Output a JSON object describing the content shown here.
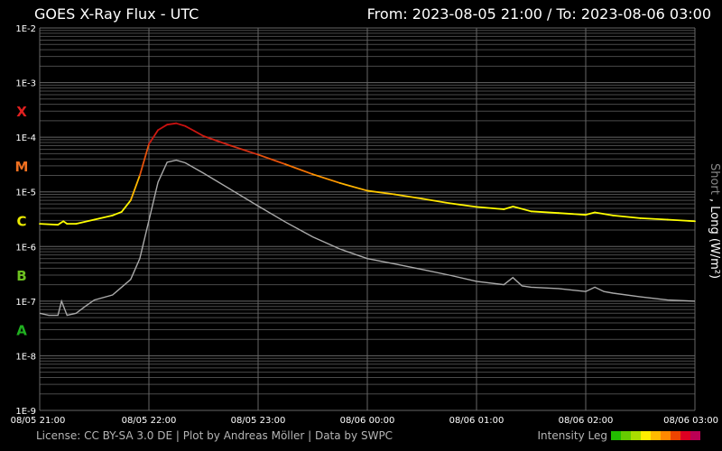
{
  "header": {
    "title": "GOES X-Ray Flux - UTC",
    "range": "From: 2023-08-05 21:00  /  To: 2023-08-06 03:00"
  },
  "footer": {
    "credits": "License: CC BY-SA 3.0 DE | Plot by Andreas Möller | Data by SWPC",
    "legend_label": "Intensity Leg",
    "legend_colors": [
      "#22bb00",
      "#66cc00",
      "#aadd00",
      "#ffee00",
      "#ffbb00",
      "#ff8800",
      "#ee4400",
      "#dd0022",
      "#bb0055"
    ]
  },
  "colors": {
    "class_X": "#e02020",
    "class_M": "#f07020",
    "class_C": "#e8e800",
    "class_B": "#6cc020",
    "class_A": "#20b020",
    "long_series_low": "#ffff00",
    "long_series_peak": "#cc1010",
    "short_series": "#aaaaaa",
    "grid": "#4a4a4a"
  },
  "chart_data": {
    "type": "line",
    "title": "GOES X-Ray Flux - UTC",
    "xlabel": "",
    "ylabel": "Short , Long (W/m²)",
    "ylabel_short": "Short",
    "ylabel_long": "Long (W/m²)",
    "y_scale": "log",
    "ylim": [
      1e-09,
      0.01
    ],
    "xlim": [
      "2023-08-05 21:00",
      "2023-08-06 03:00"
    ],
    "y_ticks": [
      "1E-2",
      "1E-3",
      "1E-4",
      "1E-5",
      "1E-6",
      "1E-7",
      "1E-8",
      "1E-9"
    ],
    "x_ticks": [
      "08/05 21:00",
      "08/05 22:00",
      "08/05 23:00",
      "08/06 00:00",
      "08/06 01:00",
      "08/06 02:00",
      "08/06 03:00"
    ],
    "flare_classes": [
      {
        "label": "X",
        "value": 0.0003
      },
      {
        "label": "M",
        "value": 3e-05
      },
      {
        "label": "C",
        "value": 3e-06
      },
      {
        "label": "B",
        "value": 3e-07
      },
      {
        "label": "A",
        "value": 3e-08
      }
    ],
    "grid": true,
    "series": [
      {
        "name": "Long",
        "x": [
          "2023-08-05 21:00",
          "2023-08-05 21:10",
          "2023-08-05 21:13",
          "2023-08-05 21:15",
          "2023-08-05 21:20",
          "2023-08-05 21:30",
          "2023-08-05 21:40",
          "2023-08-05 21:45",
          "2023-08-05 21:50",
          "2023-08-05 21:55",
          "2023-08-05 22:00",
          "2023-08-05 22:05",
          "2023-08-05 22:10",
          "2023-08-05 22:15",
          "2023-08-05 22:20",
          "2023-08-05 22:25",
          "2023-08-05 22:30",
          "2023-08-05 22:45",
          "2023-08-05 23:00",
          "2023-08-05 23:15",
          "2023-08-05 23:30",
          "2023-08-05 23:45",
          "2023-08-06 00:00",
          "2023-08-06 00:15",
          "2023-08-06 00:30",
          "2023-08-06 00:45",
          "2023-08-06 01:00",
          "2023-08-06 01:15",
          "2023-08-06 01:20",
          "2023-08-06 01:30",
          "2023-08-06 01:45",
          "2023-08-06 02:00",
          "2023-08-06 02:05",
          "2023-08-06 02:15",
          "2023-08-06 02:30",
          "2023-08-06 02:45",
          "2023-08-06 03:00"
        ],
        "y": [
          2.6e-06,
          2.5e-06,
          2.9e-06,
          2.6e-06,
          2.6e-06,
          3.1e-06,
          3.7e-06,
          4.3e-06,
          7e-06,
          2e-05,
          7.5e-05,
          0.000135,
          0.00017,
          0.00018,
          0.00016,
          0.00013,
          0.000105,
          7e-05,
          4.8e-05,
          3.2e-05,
          2.1e-05,
          1.45e-05,
          1.05e-05,
          9e-06,
          7.5e-06,
          6.2e-06,
          5.3e-06,
          4.8e-06,
          5.4e-06,
          4.4e-06,
          4.1e-06,
          3.8e-06,
          4.2e-06,
          3.7e-06,
          3.3e-06,
          3.1e-06,
          2.9e-06
        ]
      },
      {
        "name": "Short",
        "x": [
          "2023-08-05 21:00",
          "2023-08-05 21:05",
          "2023-08-05 21:10",
          "2023-08-05 21:12",
          "2023-08-05 21:15",
          "2023-08-05 21:20",
          "2023-08-05 21:25",
          "2023-08-05 21:30",
          "2023-08-05 21:40",
          "2023-08-05 21:50",
          "2023-08-05 21:55",
          "2023-08-05 22:00",
          "2023-08-05 22:05",
          "2023-08-05 22:10",
          "2023-08-05 22:15",
          "2023-08-05 22:20",
          "2023-08-05 22:30",
          "2023-08-05 22:45",
          "2023-08-05 23:00",
          "2023-08-05 23:15",
          "2023-08-05 23:30",
          "2023-08-05 23:45",
          "2023-08-06 00:00",
          "2023-08-06 00:15",
          "2023-08-06 00:30",
          "2023-08-06 00:45",
          "2023-08-06 01:00",
          "2023-08-06 01:15",
          "2023-08-06 01:20",
          "2023-08-06 01:25",
          "2023-08-06 01:30",
          "2023-08-06 01:45",
          "2023-08-06 02:00",
          "2023-08-06 02:05",
          "2023-08-06 02:10",
          "2023-08-06 02:15",
          "2023-08-06 02:30",
          "2023-08-06 02:45",
          "2023-08-06 03:00"
        ],
        "y": [
          6e-08,
          5.5e-08,
          5.5e-08,
          1e-07,
          5.5e-08,
          6e-08,
          8e-08,
          1.05e-07,
          1.3e-07,
          2.5e-07,
          6e-07,
          3e-06,
          1.5e-05,
          3.5e-05,
          3.8e-05,
          3.4e-05,
          2.2e-05,
          1.1e-05,
          5.5e-06,
          2.8e-06,
          1.5e-06,
          9e-07,
          6e-07,
          4.8e-07,
          3.8e-07,
          3e-07,
          2.3e-07,
          2e-07,
          2.7e-07,
          1.9e-07,
          1.8e-07,
          1.7e-07,
          1.5e-07,
          1.8e-07,
          1.5e-07,
          1.4e-07,
          1.2e-07,
          1.05e-07,
          1e-07
        ]
      }
    ]
  }
}
